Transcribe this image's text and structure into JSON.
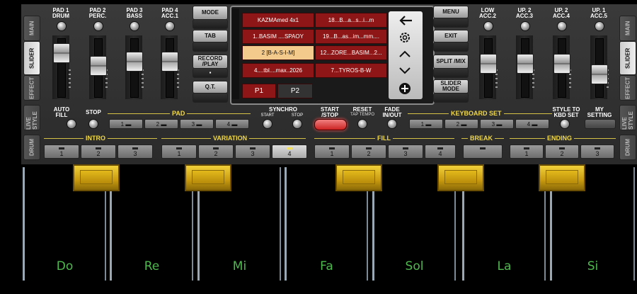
{
  "side_tabs_left": [
    "MAIN",
    "SLIDER",
    "EFFECT",
    "LIVE STYLE",
    "DRUM"
  ],
  "side_tabs_right": [
    "MAIN",
    "SLIDER",
    "EFFECT",
    "LIVE STYLE",
    "DRUM"
  ],
  "pads_left": [
    "PAD 1 DRUM",
    "PAD 2 PERC.",
    "PAD 3 BASS",
    "PAD 4 ACC.1"
  ],
  "pads_right": [
    "LOW ACC.2",
    "UP. 2 ACC.3",
    "UP. 2 ACC.4",
    "UP. 1 ACC.5"
  ],
  "mode_buttons": {
    "mode": "MODE",
    "tab": "TAB",
    "record": "RECORD /PLAY",
    "qt": "Q.T."
  },
  "presets": [
    "KAZMAmed 4x1",
    "18...B...a...s...i...m",
    "1..BASIM ....SPAOY",
    "19...B...as...im...mm....",
    "2 [B-A-S-I-M]",
    "12...ZORE...BASIM...2...",
    "4....tbl....max..2026",
    "7...TYROS-B-W"
  ],
  "pages": [
    "P1",
    "P2"
  ],
  "right_buttons": {
    "menu": "MENU",
    "exit": "EXIT",
    "split": "SPLIT /MIX",
    "slider_mode": "SLIDER MODE"
  },
  "controls": {
    "auto_fill": "AUTO FILL",
    "stop": "STOP",
    "pad": "PAD",
    "synchro": "SYNCHRO",
    "sync_start": "START",
    "sync_stop": "STOP",
    "start_stop": "START /STOP",
    "reset": "RESET",
    "tap_tempo": "TAP TEMPO",
    "fade": "FADE IN/OUT",
    "keyboard_set": "KEYBOARD SET",
    "style_to_kbd": "STYLE TO KBD SET",
    "my_setting": "MY SETTING"
  },
  "pad_numbers": [
    "1",
    "2",
    "3",
    "4"
  ],
  "kbd_numbers": [
    "1",
    "2",
    "3",
    "4"
  ],
  "sections": {
    "intro": {
      "label": "INTRO",
      "buttons": [
        "1",
        "2",
        "3"
      ]
    },
    "variation": {
      "label": "VARIATION",
      "buttons": [
        "1",
        "2",
        "3",
        "4"
      ]
    },
    "fill": {
      "label": "FILL",
      "buttons": [
        "1",
        "2",
        "3",
        "4"
      ]
    },
    "break": {
      "label": "BREAK"
    },
    "ending": {
      "label": "ENDING",
      "buttons": [
        "1",
        "2",
        "3"
      ]
    }
  },
  "keys": [
    "Do",
    "Re",
    "Mi",
    "Fa",
    "Sol",
    "La",
    "Si"
  ],
  "fader_levels": [
    0.85,
    0.55,
    0.65,
    0.65,
    0.6,
    0.6,
    0.6,
    0.35
  ],
  "colors": {
    "accent": "#f0d84a",
    "preset_bg": "#8e1616",
    "preset_selected": "#f3c98c",
    "key_label": "#4fb84f"
  }
}
